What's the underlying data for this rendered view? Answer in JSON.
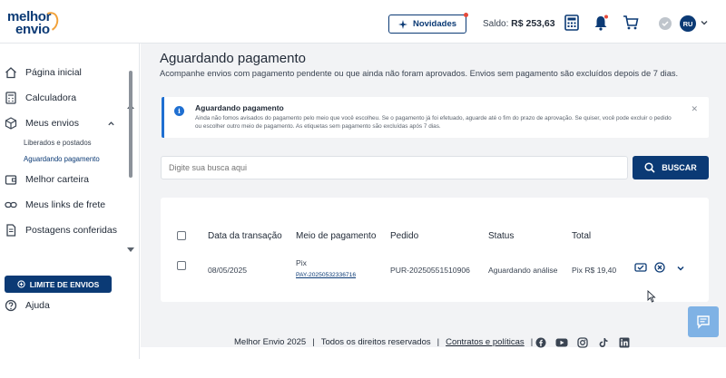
{
  "header": {
    "logo_line1": "melhor",
    "logo_line2": "envio",
    "novidades_label": "Novidades",
    "saldo_label": "Saldo:",
    "saldo_value": "R$ 253,63",
    "avatar_initials": "RU"
  },
  "sidebar": {
    "items": [
      {
        "label": "Página inicial"
      },
      {
        "label": "Calculadora"
      },
      {
        "label": "Meus envios"
      },
      {
        "label": "Melhor carteira"
      },
      {
        "label": "Meus links de frete"
      },
      {
        "label": "Postagens conferidas"
      }
    ],
    "sub_items": [
      {
        "label": "Liberados e postados"
      },
      {
        "label": "Aguardando pagamento"
      }
    ],
    "limit_button": "LIMITE DE ENVIOS",
    "help_label": "Ajuda"
  },
  "main": {
    "title": "Aguardando pagamento",
    "subtitle": "Acompanhe envios com pagamento pendente ou que ainda não foram aprovados. Envios sem pagamento são excluídos depois de 7 dias.",
    "alert": {
      "title": "Aguardando pagamento",
      "body": "Ainda não fomos avisados do pagamento pelo meio que você escolheu. Se o pagamento já foi efetuado, aguarde até o fim do prazo de aprovação. Se quiser, você pode excluir o pedido ou escolher outro meio de pagamento. As etiquetas sem pagamento são excluídas após 7 dias."
    },
    "search": {
      "placeholder": "Digite sua busca aqui",
      "button": "BUSCAR"
    },
    "table": {
      "headers": [
        "Data da transação",
        "Meio de pagamento",
        "Pedido",
        "Status",
        "Total"
      ],
      "rows": [
        {
          "date": "08/05/2025",
          "method": "Pix",
          "method_id": "PAY-20250532336716",
          "order": "PUR-20250551510906",
          "status": "Aguardando análise",
          "total": "Pix R$ 19,40"
        }
      ]
    }
  },
  "footer": {
    "brand": "Melhor Envio 2025",
    "rights": "Todos os direitos reservados",
    "contracts": "Contratos e políticas"
  },
  "colors": {
    "primary": "#0b3a75",
    "info": "#1f6fd1",
    "accent": "#f2a23a",
    "notification": "#e5493a"
  }
}
